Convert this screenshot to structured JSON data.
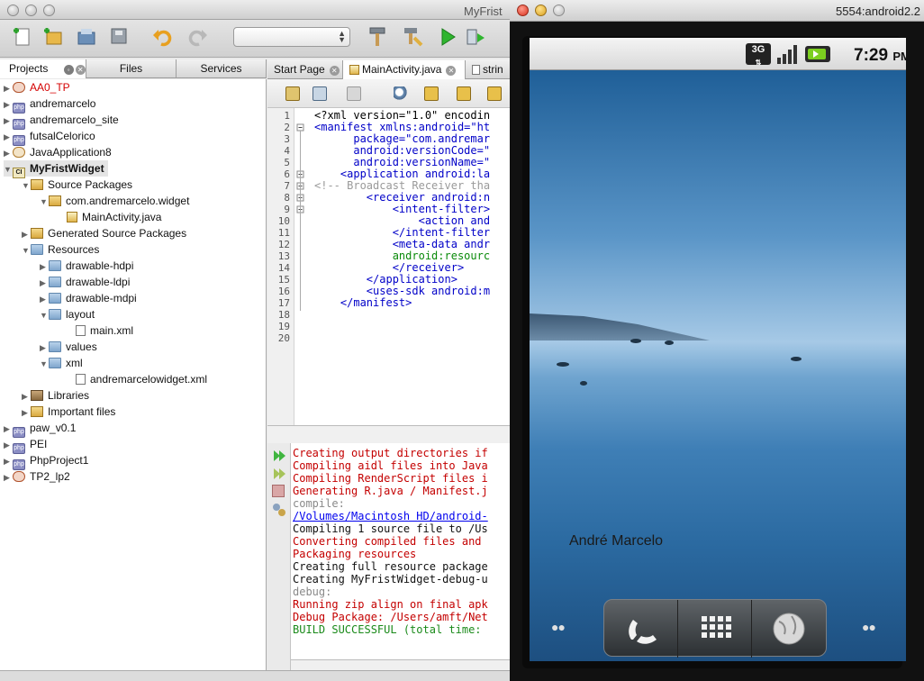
{
  "ide": {
    "window_title": "MyFrist",
    "panel_tabs": [
      "Projects",
      "Files",
      "Services"
    ],
    "tree": [
      {
        "label": "AA0_TP",
        "icon": "java-project-icon",
        "color": "#d40000"
      },
      {
        "label": "andremarcelo",
        "icon": "php-project-icon"
      },
      {
        "label": "andremarcelo_site",
        "icon": "php-project-icon"
      },
      {
        "label": "futsalCelorico",
        "icon": "php-project-icon"
      },
      {
        "label": "JavaApplication8",
        "icon": "java-project-icon"
      },
      {
        "label": "MyFristWidget",
        "icon": "ci-project-icon"
      },
      {
        "label": "Source Packages",
        "icon": "source-packages-icon"
      },
      {
        "label": "com.andremarcelo.widget",
        "icon": "package-icon"
      },
      {
        "label": "MainActivity.java",
        "icon": "java-file-icon"
      },
      {
        "label": "Generated Source Packages",
        "icon": "source-packages-icon"
      },
      {
        "label": "Resources",
        "icon": "folder-icon"
      },
      {
        "label": "drawable-hdpi",
        "icon": "folder-icon"
      },
      {
        "label": "drawable-ldpi",
        "icon": "folder-icon"
      },
      {
        "label": "drawable-mdpi",
        "icon": "folder-icon"
      },
      {
        "label": "layout",
        "icon": "folder-icon"
      },
      {
        "label": "main.xml",
        "icon": "xml-file-icon"
      },
      {
        "label": "values",
        "icon": "folder-icon"
      },
      {
        "label": "xml",
        "icon": "folder-icon"
      },
      {
        "label": "andremarcelowidget.xml",
        "icon": "xml-file-icon"
      },
      {
        "label": "Libraries",
        "icon": "libraries-icon"
      },
      {
        "label": "Important files",
        "icon": "important-files-icon"
      },
      {
        "label": "paw_v0.1",
        "icon": "php-project-icon"
      },
      {
        "label": "PEI",
        "icon": "php-project-icon"
      },
      {
        "label": "PhpProject1",
        "icon": "php-project-icon"
      },
      {
        "label": "TP2_lp2",
        "icon": "java-project-icon"
      }
    ],
    "editor_tabs": [
      "Start Page",
      "MainActivity.java",
      "strin"
    ],
    "line_numbers": [
      "1",
      "2",
      "3",
      "4",
      "5",
      "6",
      "7",
      "8",
      "9",
      "10",
      "11",
      "12",
      "13",
      "14",
      "15",
      "16",
      "17",
      "18",
      "19",
      "20"
    ],
    "code": [
      "<?xml version=\"1.0\" encodin",
      "<manifest xmlns:android=\"ht",
      "      package=\"com.andremar",
      "      android:versionCode=\"",
      "      android:versionName=\"",
      "    <application android:la",
      "<!-- Broadcast Receiver tha",
      "        <receiver android:n",
      "            <intent-filter>",
      "                <action and",
      "            </intent-filter",
      "            <meta-data andr",
      "            android:resourc",
      "            </receiver>",
      "        </application>",
      "        <uses-sdk android:m",
      "    </manifest>",
      "",
      "",
      ""
    ],
    "output": [
      {
        "text": "Creating output directories if",
        "color": "#c40000"
      },
      {
        "text": "Compiling aidl files into Java",
        "color": "#c40000"
      },
      {
        "text": "Compiling RenderScript files i",
        "color": "#c40000"
      },
      {
        "text": "Generating R.java / Manifest.j",
        "color": "#c40000"
      },
      {
        "text": "compile:",
        "color": "#8a8a8a"
      },
      {
        "text": "/Volumes/Macintosh HD/android-",
        "color": "#0000ee"
      },
      {
        "text": "Compiling 1 source file to /Us",
        "color": "#111111"
      },
      {
        "text": "Converting compiled files and",
        "color": "#c40000"
      },
      {
        "text": "Packaging resources",
        "color": "#c40000"
      },
      {
        "text": "Creating full resource package",
        "color": "#111111"
      },
      {
        "text": "Creating MyFristWidget-debug-u",
        "color": "#111111"
      },
      {
        "text": "debug:",
        "color": "#8a8a8a"
      },
      {
        "text": "Running zip align on final apk",
        "color": "#c40000"
      },
      {
        "text": "Debug Package: /Users/amft/Net",
        "color": "#c40000"
      },
      {
        "text": "BUILD SUCCESSFUL (total time:",
        "color": "#1a8a1a"
      }
    ]
  },
  "emulator": {
    "window_title": "5554:android2.2",
    "network": "3G",
    "time": "7:29",
    "ampm": "PM",
    "widget_text": "André Marcelo"
  }
}
